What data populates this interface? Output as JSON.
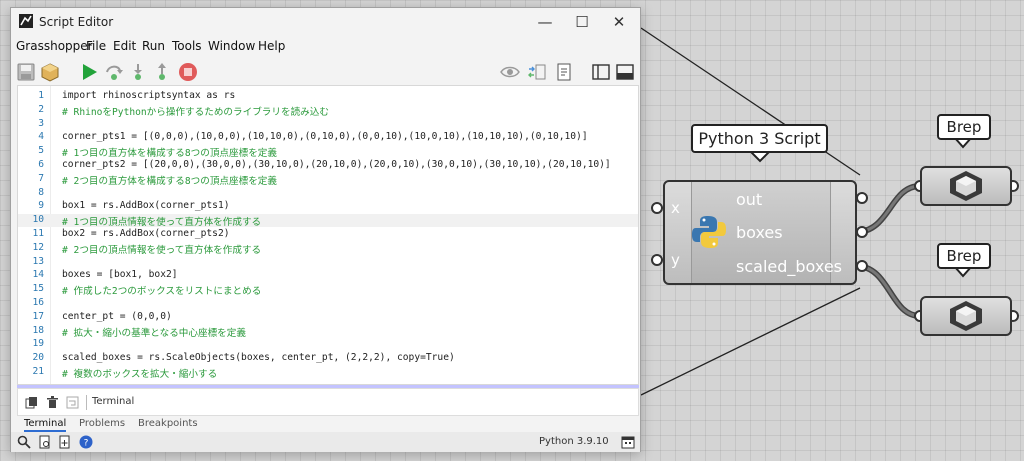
{
  "window": {
    "title": "Script Editor",
    "menu": [
      "Grasshopper",
      "File",
      "Edit",
      "Run",
      "Tools",
      "Window",
      "Help"
    ],
    "controls": {
      "minimize": "—",
      "maximize": "☐",
      "close": "✕"
    }
  },
  "toolbar": {
    "icons": [
      "save-icon",
      "package-icon",
      "run-icon",
      "step-over-icon",
      "step-into-icon",
      "step-out-icon",
      "stop-icon",
      "preview-icon",
      "compare-icon",
      "notes-icon",
      "panel-left-icon",
      "panel-bottom-icon"
    ]
  },
  "editor": {
    "active_line": 10,
    "lines": [
      {
        "n": "1",
        "text": "import rhinoscriptsyntax as rs",
        "type": "code"
      },
      {
        "n": "2",
        "text": "# RhinoをPythonから操作するためのライブラリを読み込む",
        "type": "comment"
      },
      {
        "n": "3",
        "text": "",
        "type": "code"
      },
      {
        "n": "4",
        "text": "corner_pts1 = [(0,0,0),(10,0,0),(10,10,0),(0,10,0),(0,0,10),(10,0,10),(10,10,10),(0,10,10)]",
        "type": "code"
      },
      {
        "n": "5",
        "text": "# 1つ目の直方体を構成する8つの頂点座標を定義",
        "type": "comment"
      },
      {
        "n": "6",
        "text": "corner_pts2 = [(20,0,0),(30,0,0),(30,10,0),(20,10,0),(20,0,10),(30,0,10),(30,10,10),(20,10,10)]",
        "type": "code"
      },
      {
        "n": "7",
        "text": "# 2つ目の直方体を構成する8つの頂点座標を定義",
        "type": "comment"
      },
      {
        "n": "8",
        "text": "",
        "type": "code"
      },
      {
        "n": "9",
        "text": "box1 = rs.AddBox(corner_pts1)",
        "type": "code"
      },
      {
        "n": "10",
        "text": "# 1つ目の頂点情報を使って直方体を作成する",
        "type": "comment"
      },
      {
        "n": "11",
        "text": "box2 = rs.AddBox(corner_pts2)",
        "type": "code"
      },
      {
        "n": "12",
        "text": "# 2つ目の頂点情報を使って直方体を作成する",
        "type": "comment"
      },
      {
        "n": "13",
        "text": "",
        "type": "code"
      },
      {
        "n": "14",
        "text": "boxes = [box1, box2]",
        "type": "code"
      },
      {
        "n": "15",
        "text": "# 作成した2つのボックスをリストにまとめる",
        "type": "comment"
      },
      {
        "n": "16",
        "text": "",
        "type": "code"
      },
      {
        "n": "17",
        "text": "center_pt = (0,0,0)",
        "type": "code"
      },
      {
        "n": "18",
        "text": "# 拡大・縮小の基準となる中心座標を定義",
        "type": "comment"
      },
      {
        "n": "19",
        "text": "",
        "type": "code"
      },
      {
        "n": "20",
        "text": "scaled_boxes = rs.ScaleObjects(boxes, center_pt, (2,2,2), copy=True)",
        "type": "code"
      },
      {
        "n": "21",
        "text": "# 複数のボックスを拡大・縮小する",
        "type": "comment"
      }
    ]
  },
  "terminal": {
    "label": "Terminal"
  },
  "tabs": [
    {
      "label": "Terminal",
      "active": true
    },
    {
      "label": "Problems",
      "active": false
    },
    {
      "label": "Breakpoints",
      "active": false
    }
  ],
  "status": {
    "version": "Python 3.9.10"
  },
  "canvas": {
    "component_name": "Python 3 Script",
    "inputs": [
      "x",
      "y"
    ],
    "outputs": [
      "out",
      "boxes",
      "scaled_boxes"
    ],
    "brep_labels": [
      "Brep",
      "Brep"
    ]
  },
  "colors": {
    "comment": "#2b9a3c",
    "line_number": "#2b78b0",
    "splitter": "#c3c3ff",
    "run_green": "#22a33a",
    "stop_red": "#e05a5a"
  }
}
